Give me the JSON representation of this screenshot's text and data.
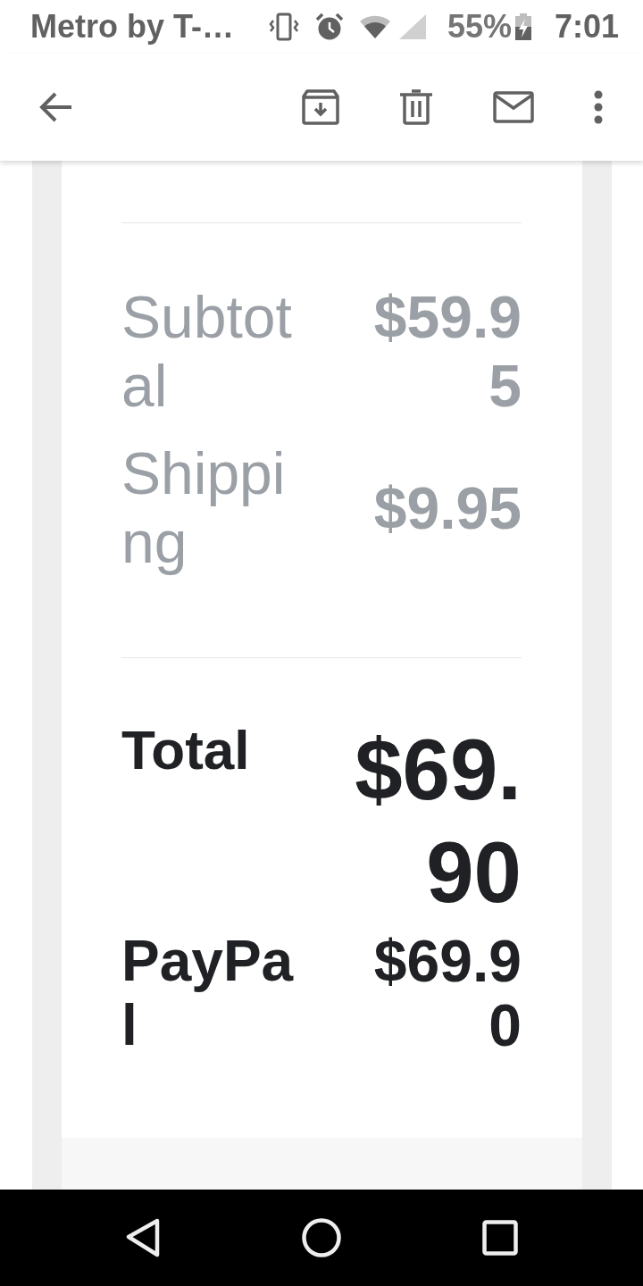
{
  "status_bar": {
    "carrier": "Metro by T-…",
    "battery": "55%",
    "time": "7:01"
  },
  "receipt": {
    "sections": [
      {
        "rows": [
          {
            "kind": "item",
            "label": "Subtotal",
            "amount": "$59.95"
          },
          {
            "kind": "item",
            "label": "Shipping",
            "amount": "$9.95"
          }
        ]
      },
      {
        "rows": [
          {
            "kind": "total",
            "label": "Total",
            "amount": "$69.90"
          },
          {
            "kind": "payment",
            "label": "PayPal",
            "amount": "$69.90"
          }
        ]
      }
    ]
  }
}
